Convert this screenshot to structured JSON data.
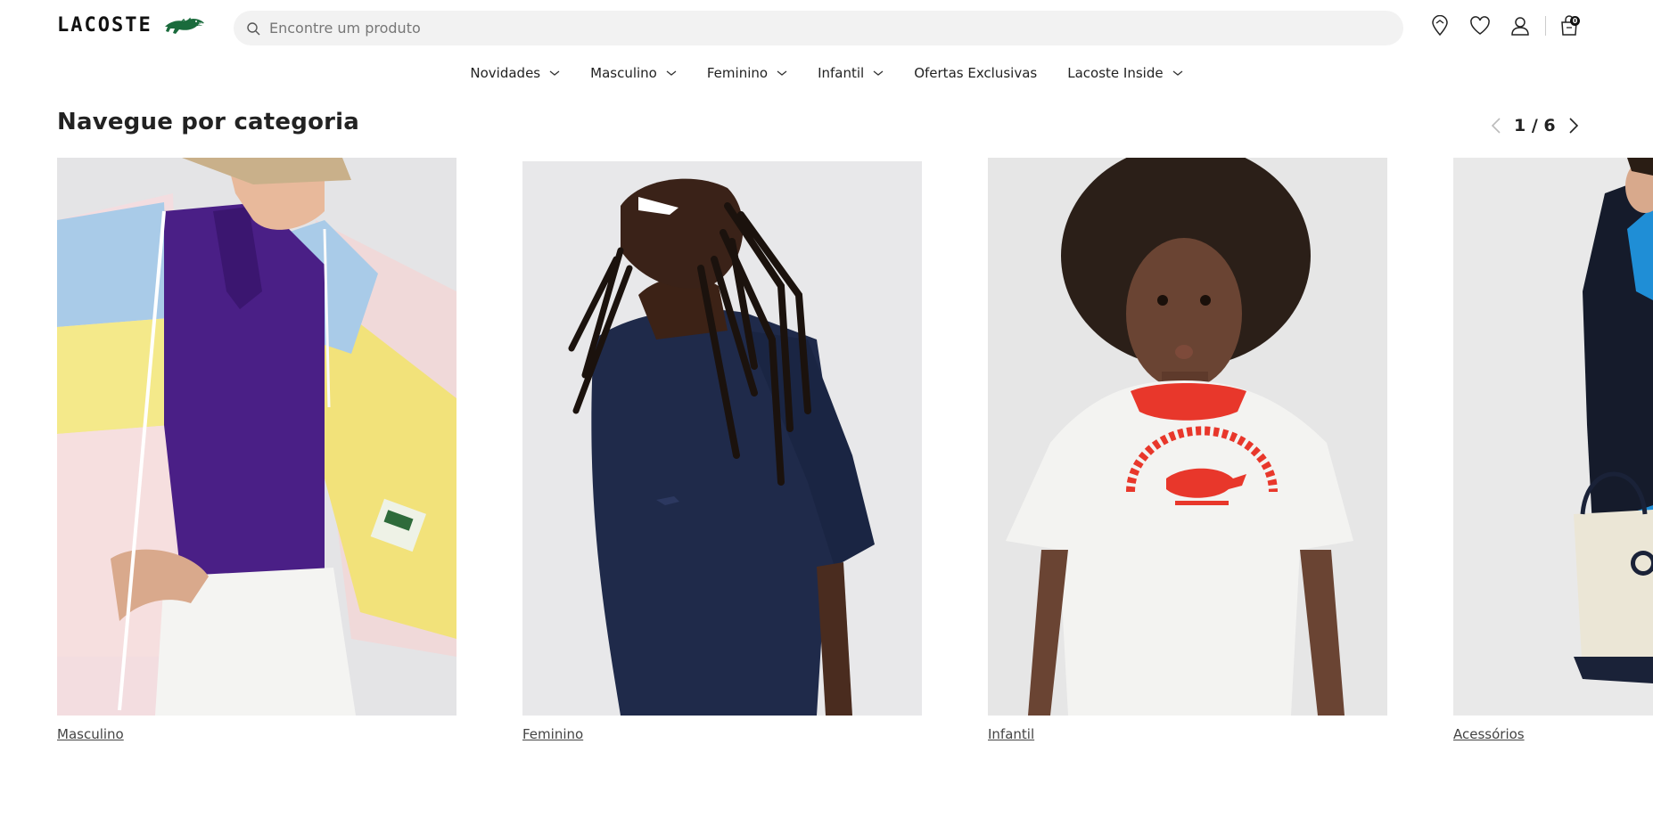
{
  "header": {
    "logo_text": "LACOSTE",
    "search_placeholder": "Encontre um produto",
    "cart_count": "0",
    "icons": [
      "store-locator-icon",
      "heart-icon",
      "user-icon",
      "shopping-bag-icon"
    ]
  },
  "nav": {
    "items": [
      {
        "label": "Novidades",
        "has_dropdown": true
      },
      {
        "label": "Masculino",
        "has_dropdown": true
      },
      {
        "label": "Feminino",
        "has_dropdown": true
      },
      {
        "label": "Infantil",
        "has_dropdown": true
      },
      {
        "label": "Ofertas Exclusivas",
        "has_dropdown": false
      },
      {
        "label": "Lacoste Inside",
        "has_dropdown": true
      }
    ]
  },
  "section": {
    "title": "Navegue por categoria",
    "pager": "1 / 6"
  },
  "categories": [
    {
      "label": "Masculino"
    },
    {
      "label": "Feminino"
    },
    {
      "label": "Infantil"
    },
    {
      "label": "Acessórios"
    }
  ],
  "colors": {
    "brand_green": "#1a6b3c",
    "text": "#222222",
    "search_bg": "#f2f2f2",
    "navy": "#1e2a4a",
    "purple": "#4a1e8a",
    "red": "#e8372b"
  }
}
